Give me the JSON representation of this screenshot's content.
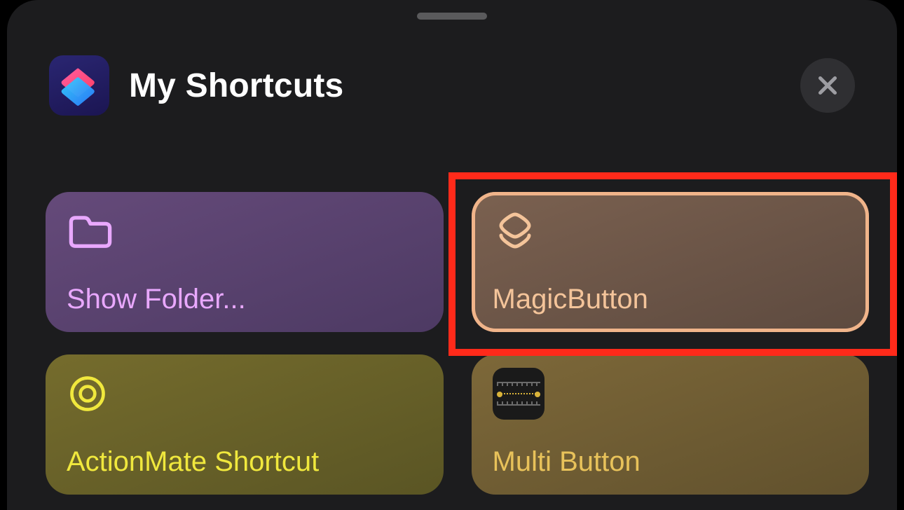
{
  "header": {
    "title": "My Shortcuts",
    "app_icon_name": "shortcuts-app-icon",
    "close_label": "Close"
  },
  "tiles": [
    {
      "id": "show-folder",
      "label": "Show Folder...",
      "icon": "folder-icon",
      "theme": "purple",
      "highlighted": false
    },
    {
      "id": "magicbutton",
      "label": "MagicButton",
      "icon": "stack-icon",
      "theme": "brown",
      "highlighted": true
    },
    {
      "id": "actionmate",
      "label": "ActionMate Shortcut",
      "icon": "target-icon",
      "theme": "olive",
      "highlighted": false
    },
    {
      "id": "multi-button",
      "label": "Multi Button",
      "icon": "measure-icon",
      "theme": "tan",
      "highlighted": false
    }
  ]
}
